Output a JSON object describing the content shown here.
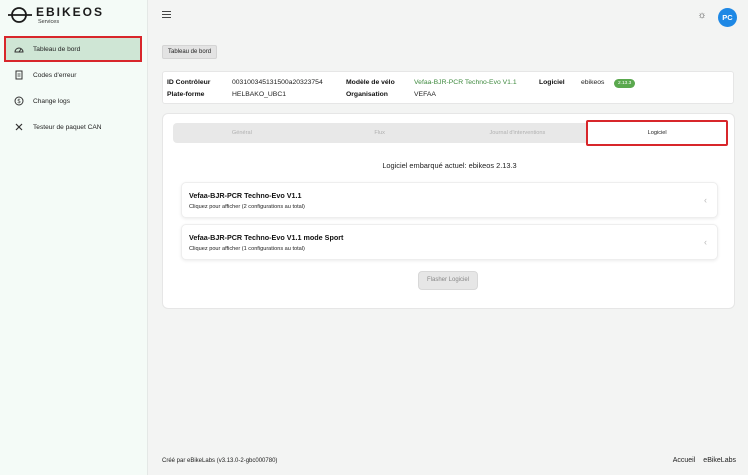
{
  "brand": {
    "title": "EBIKEOS",
    "subtitle": "Services"
  },
  "sidebar": {
    "items": [
      {
        "label": "Tableau de bord",
        "icon": "dashboard-icon"
      },
      {
        "label": "Codes d'erreur",
        "icon": "clipboard-icon"
      },
      {
        "label": "Change logs",
        "icon": "dollar-circle-icon"
      },
      {
        "label": "Testeur de paquet CAN",
        "icon": "tools-icon"
      }
    ]
  },
  "header": {
    "avatar_initials": "PC",
    "theme_icon": "sun-icon"
  },
  "breadcrumb": "Tableau de bord",
  "info": {
    "controller_label": "ID Contrôleur",
    "controller_value": "003100345131500a20323754",
    "platform_label": "Plate-forme",
    "platform_value": "HELBAKO_UBC1",
    "model_label": "Modèle de vélo",
    "model_value": "Vefaa-BJR-PCR Techno-Evo V1.1",
    "org_label": "Organisation",
    "org_value": "VEFAA",
    "software_label": "Logiciel",
    "software_value": "ebikeos",
    "software_version": "2.13.3"
  },
  "tabs": [
    "Général",
    "Flux",
    "Journal d'interventions",
    "Logiciel"
  ],
  "active_tab": "Logiciel",
  "software": {
    "embedded": "Logiciel embarqué actuel: ebikeos 2.13.3",
    "configs": [
      {
        "title": "Vefaa-BJR-PCR Techno-Evo V1.1",
        "subtitle": "Cliquez pour afficher (2 configurations au total)"
      },
      {
        "title": "Vefaa-BJR-PCR Techno-Evo V1.1 mode Sport",
        "subtitle": "Cliquez pour afficher (1 configurations au total)"
      }
    ],
    "flash_label": "Flasher Logiciel"
  },
  "footer": {
    "created": "Créé par eBikeLabs (v3.13.0-2-gbc000780)",
    "home": "Accueil",
    "labs": "eBikeLabs"
  },
  "colors": {
    "accent_green": "#5aa84e",
    "highlight_red": "#d8262b",
    "avatar_blue": "#1e88e5",
    "active_nav": "#cfe6d5"
  }
}
